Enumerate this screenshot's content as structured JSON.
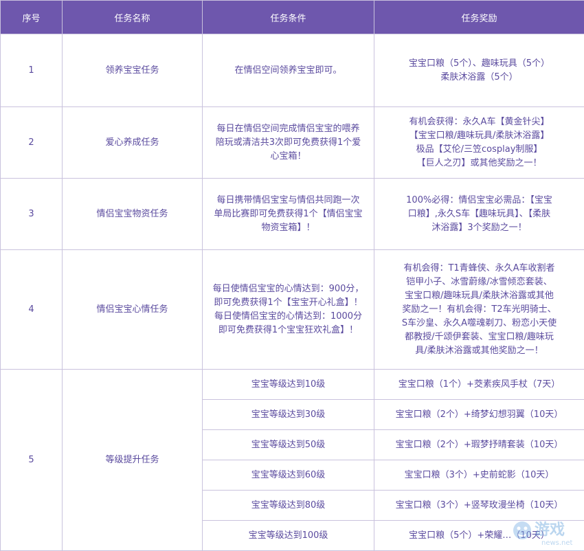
{
  "headers": [
    "序号",
    "任务名称",
    "任务条件",
    "任务奖励"
  ],
  "rows": [
    {
      "id": "1",
      "name": "领养宝宝任务",
      "condition": "在情侣空间领养宝宝即可。",
      "reward_lines": [
        "宝宝口粮（5个）、趣味玩具（5个）",
        "柔肤沐浴露（5个）"
      ]
    },
    {
      "id": "2",
      "name": "爱心养成任务",
      "condition_lines": [
        "每日在情侣空间完成情侣宝宝的喂养",
        "陪玩或清洁共3次即可免费获得1个爱",
        "心宝箱！"
      ],
      "reward_lines": [
        "有机会获得：永久A车【黄金针尖】",
        "【宝宝口粮/趣味玩具/柔肤沐浴露】",
        "极品【艾伦/三笠cosplay制服】",
        "【巨人之刃】或其他奖励之一！"
      ]
    },
    {
      "id": "3",
      "name": "情侣宝宝物资任务",
      "condition_lines": [
        "每日携带情侣宝宝与情侣共同跑一次",
        "单局比赛即可免费获得1个【情侣宝宝",
        "物资宝箱】！"
      ],
      "reward_lines": [
        "100%必得：情侣宝宝必需品：【宝宝",
        "口粮】,永久S车【趣味玩具】、【柔肤",
        "沐浴露】3个奖励之一！"
      ]
    },
    {
      "id": "4",
      "name": "情侣宝宝心情任务",
      "condition_lines": [
        "每日使情侣宝宝的心情达到：900分，",
        "即可免费获得1个【宝宝开心礼盒】！",
        "每日使情侣宝宝的心情达到：1000分",
        "即可免费获得1个宝宝狂欢礼盒】！"
      ],
      "reward_lines": [
        "有机会得：T1青蜂侠、永久A车收割者",
        "铠甲小子、冰雪蔚缘/冰雪倾恋套装、",
        "宝宝口粮/趣味玩具/柔肤沐浴露或其他",
        "奖励之一！有机会得：T2车光明骑士、",
        "S车沙皇、永久A噬魂剃刀、粉恋小天使",
        "都教授/千颂伊套装、宝宝口粮/趣味玩",
        "具/柔肤沐浴露或其他奖励之一！"
      ]
    }
  ],
  "level_task": {
    "id": "5",
    "name": "等级提升任务",
    "items": [
      {
        "condition": "宝宝等级达到10级",
        "reward": "宝宝口粮（1个）+茭素疾风手杖（7天）"
      },
      {
        "condition": "宝宝等级达到30级",
        "reward": "宝宝口粮（2个）+绮梦幻想羽翼（10天）"
      },
      {
        "condition": "宝宝等级达到50级",
        "reward": "宝宝口粮（2个）+瑕梦抒晴套装（10天）"
      },
      {
        "condition": "宝宝等级达到60级",
        "reward": "宝宝口粮（3个）+史前蛇影（10天）"
      },
      {
        "condition": "宝宝等级达到80级",
        "reward": "宝宝口粮（3个）+竖琴玫漫坐椅（10天）"
      },
      {
        "condition": "宝宝等级达到100级",
        "reward": "宝宝口粮（5个）+荣耀…（10天）"
      }
    ]
  },
  "watermark": {
    "text": "游戏",
    "sub": "news.net"
  }
}
